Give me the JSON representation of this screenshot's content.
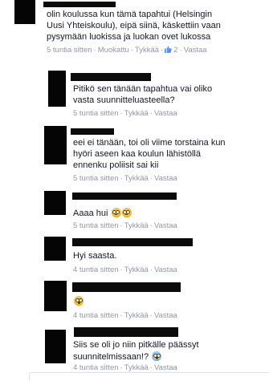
{
  "comments": [
    {
      "lines": [
        "olin koulussa kun tämä tapahtui (Helsingin",
        "Uusi Yhteiskoulu), eipä siinä, käskettiin vaan",
        "pysymään luokissa ja luokan ovet lukossa"
      ],
      "time": "5 tuntia sitten",
      "edited": "Muokattu",
      "like": "Tykkää",
      "like_count": "2",
      "reply": "Vastaa"
    },
    {
      "lines": [
        "Pitikö sen tänään tapahtua vai oliko",
        "vasta suunnitteluasteella?"
      ],
      "time": "5 tuntia sitten",
      "like": "Tykkää",
      "reply": "Vastaa"
    },
    {
      "lines": [
        "eei ei tänään, toi oli viime torstaina kun",
        "hyöri aseen kaa koulun lähistöllä",
        "ennenku poliisit sai kii"
      ],
      "time": "5 tuntia sitten",
      "like": "Tykkää",
      "reply": "Vastaa"
    },
    {
      "lines": [
        "Aaaa hui"
      ],
      "time": "5 tuntia sitten",
      "like": "Tykkää",
      "reply": "Vastaa"
    },
    {
      "lines": [
        "Hyi saasta."
      ],
      "time": "4 tuntia sitten",
      "like": "Tykkää",
      "reply": "Vastaa"
    },
    {
      "lines": [],
      "time": "4 tuntia sitten",
      "like": "Tykkää",
      "reply": "Vastaa"
    },
    {
      "lines": [
        "Siis se oli jo niin pitkälle päässyt",
        "suunnitelmissaan!?"
      ],
      "time": "4 tuntia sitten",
      "like": "Tykkää",
      "reply": "Vastaa"
    }
  ],
  "separator": "·",
  "icons": {
    "like": "thumbs-up-icon",
    "emoji_flushed": "flushed-face-emoji-icon",
    "emoji_astonished": "astonished-face-emoji-icon",
    "emoji_scream": "screaming-face-emoji-icon"
  },
  "colors": {
    "meta_text": "#9197a3",
    "body_text": "#141823",
    "like_blue": "#5890ff"
  }
}
